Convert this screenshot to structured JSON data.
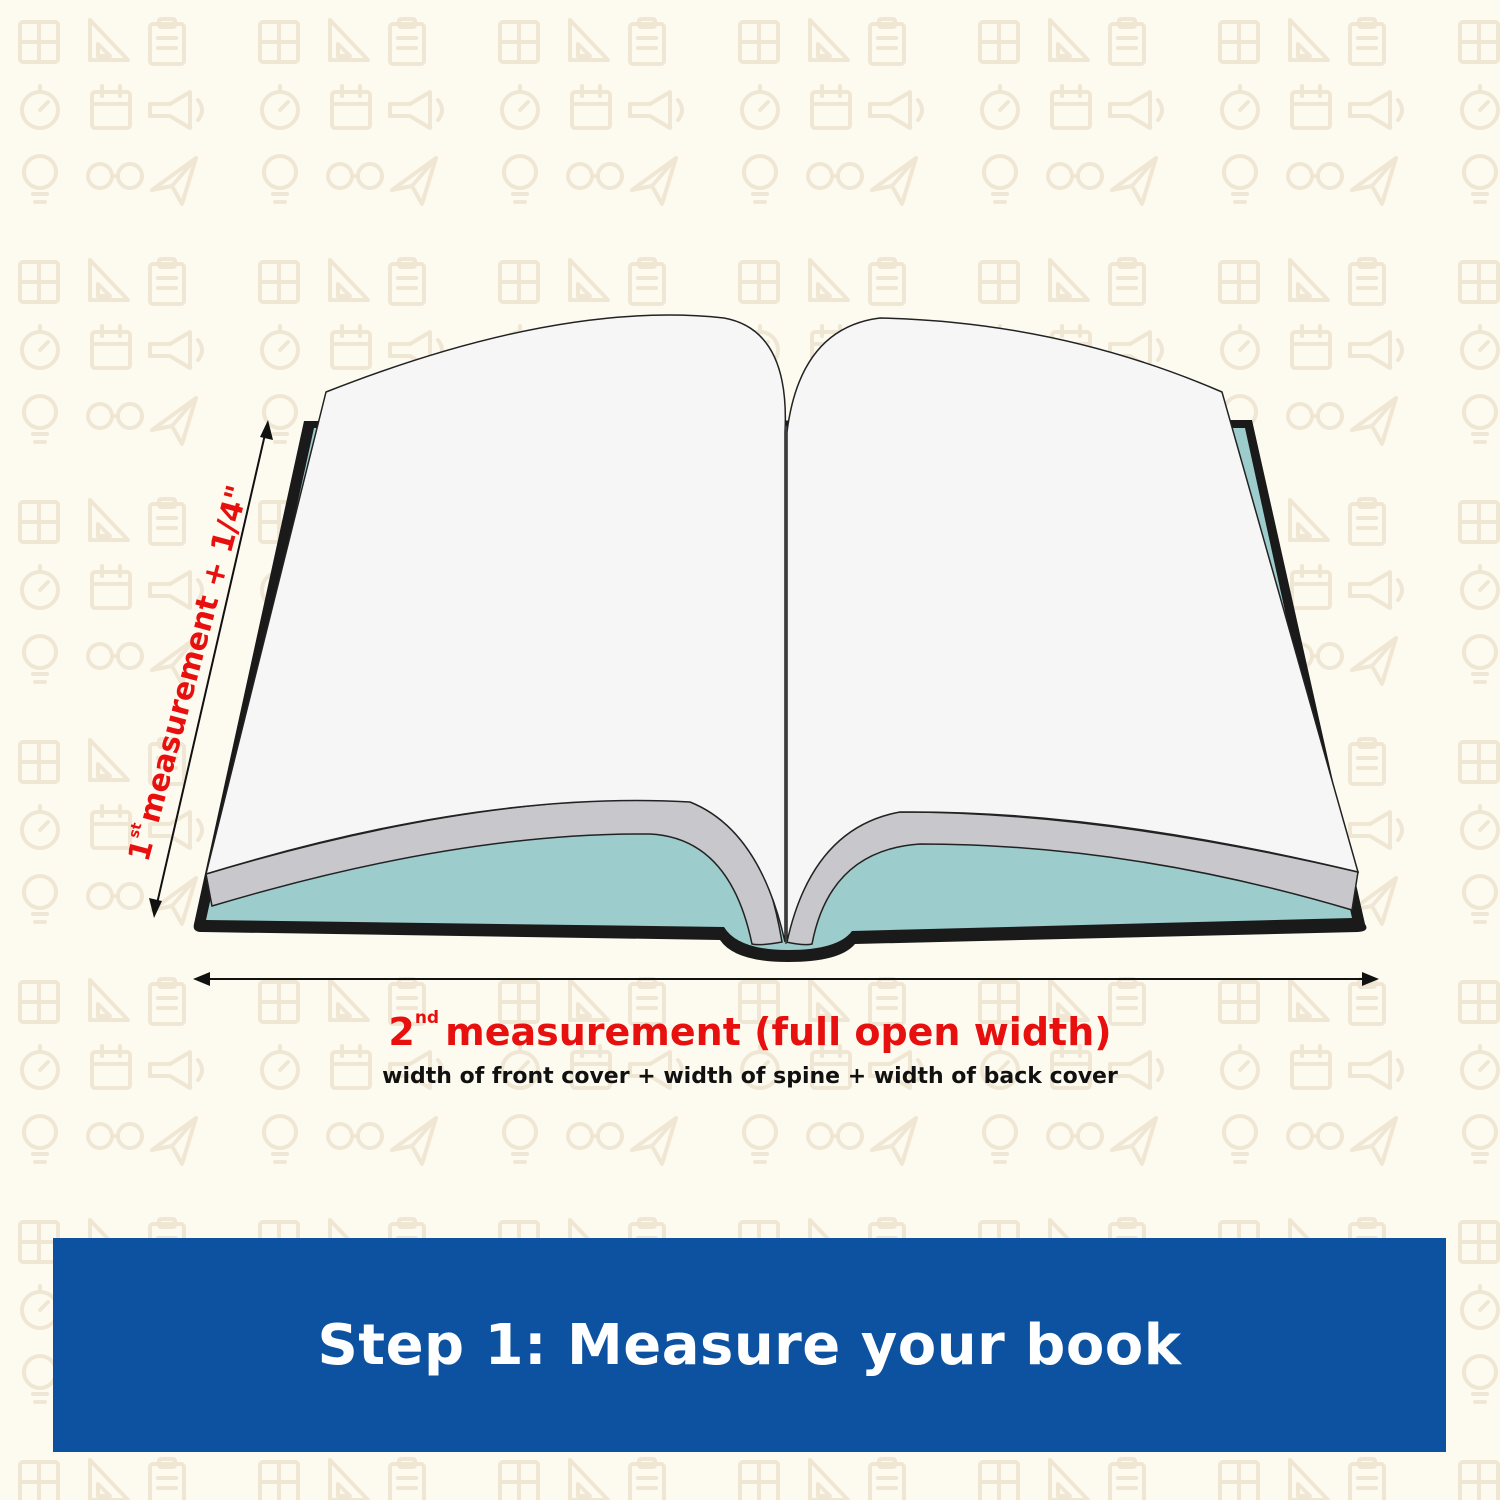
{
  "first_measurement": {
    "ordinal": "1",
    "suffix": "st",
    "text": "measurement + 1/4\""
  },
  "second_measurement": {
    "ordinal": "2",
    "suffix": "nd",
    "text": "measurement (full open width)",
    "subtext": "width of front cover + width of spine + width of back cover"
  },
  "banner": {
    "title": "Step 1: Measure your book"
  },
  "colors": {
    "background": "#fdfbef",
    "pattern_icon": "#f0e6d4",
    "measurement_text": "#e8100f",
    "banner": "#0c52a0",
    "cover_inside": "#9ccccc",
    "cover_edge": "#1a1a1a",
    "page": "#f6f6f6",
    "page_edge": "#c8c8cc"
  },
  "background_icons": [
    "calculator-icon",
    "ruler-triangle-icon",
    "clipboard-icon",
    "stopwatch-icon",
    "calendar-icon",
    "megaphone-icon",
    "lightbulb-icon",
    "glasses-icon",
    "desk-lamp-icon",
    "medal-icon",
    "paper-plane-icon",
    "push-pin-icon",
    "briefcase-icon",
    "pencil-cup-icon",
    "paperclip-icon",
    "money-bill-icon"
  ]
}
